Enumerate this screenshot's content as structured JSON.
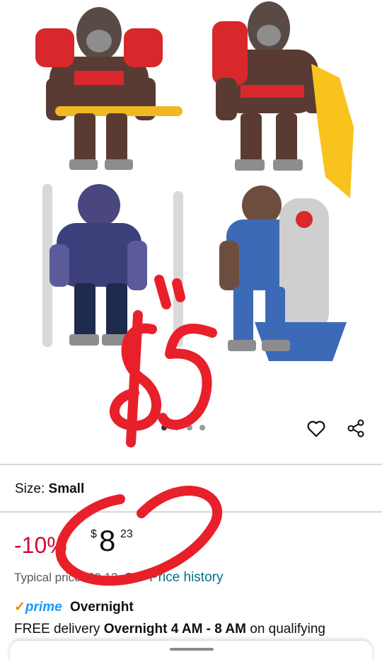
{
  "gallery": {
    "image_alt": "Toy gorilla figures with accessories",
    "dots_count": 4,
    "active_dot": 0
  },
  "actions": {
    "wishlist_icon": "heart-icon",
    "share_icon": "share-icon"
  },
  "size": {
    "label": "Size:",
    "value": "Small"
  },
  "price": {
    "discount": "-10%",
    "currency": "$",
    "whole": "8",
    "fraction": "23"
  },
  "typical": {
    "label": "Typical price:",
    "value": "$9.13",
    "history_link": "Price history"
  },
  "prime": {
    "check": "✓",
    "brand": "prime",
    "label": "Overnight"
  },
  "delivery": {
    "prefix": "FREE delivery",
    "window": "Overnight 4 AM - 8 AM",
    "suffix": "on qualifying"
  },
  "annotation": {
    "handwritten_text": "$5",
    "color": "#e8202a"
  },
  "colors": {
    "discount": "#cc0c39",
    "link": "#007185",
    "prime": "#1399ff",
    "check": "#f08804"
  }
}
